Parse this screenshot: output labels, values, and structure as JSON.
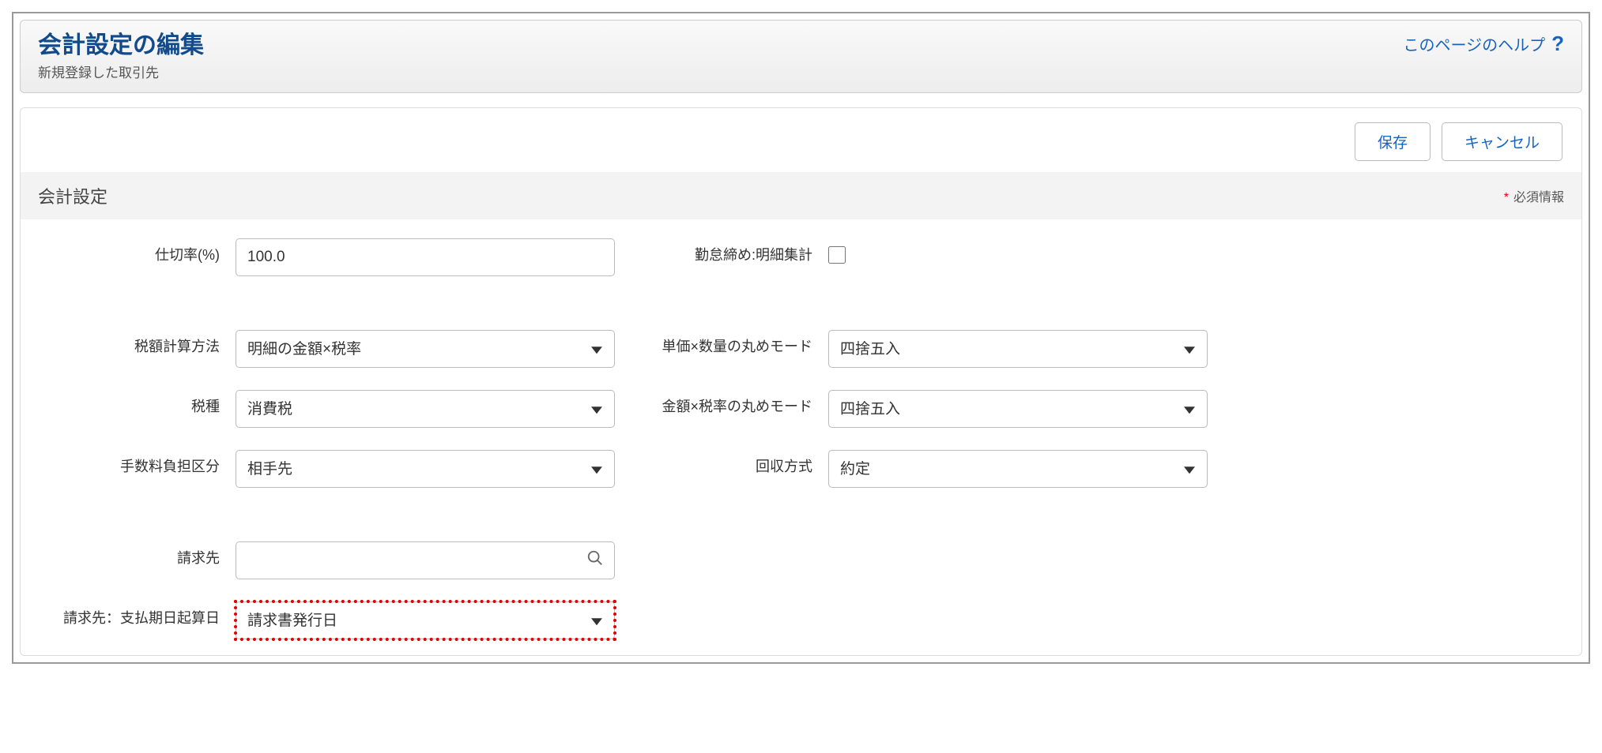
{
  "header": {
    "title": "会計設定の編集",
    "subtitle": "新規登録した取引先",
    "help_text": "このページのヘルプ"
  },
  "buttons": {
    "save": "保存",
    "cancel": "キャンセル"
  },
  "section": {
    "title": "会計設定",
    "required": "必須情報"
  },
  "fields": {
    "partition_rate": {
      "label": "仕切率(%)",
      "value": "100.0"
    },
    "attendance_summary": {
      "label": "勤怠締め:明細集計"
    },
    "tax_calc_method": {
      "label": "税額計算方法",
      "value": "明細の金額×税率"
    },
    "unit_qty_round": {
      "label": "単価×数量の丸めモード",
      "value": "四捨五入"
    },
    "tax_type": {
      "label": "税種",
      "value": "消費税"
    },
    "amount_rate_round": {
      "label": "金額×税率の丸めモード",
      "value": "四捨五入"
    },
    "fee_burden": {
      "label": "手数料負担区分",
      "value": "相手先"
    },
    "collection_method": {
      "label": "回収方式",
      "value": "約定"
    },
    "billing_dest": {
      "label": "請求先",
      "value": ""
    },
    "billing_due_basis": {
      "label": "請求先：支払期日起算日",
      "value": "請求書発行日"
    }
  }
}
